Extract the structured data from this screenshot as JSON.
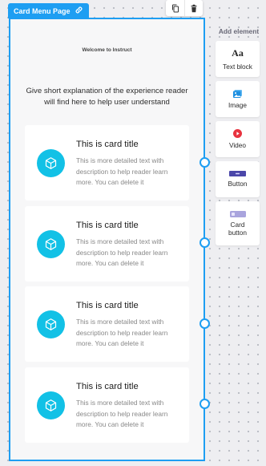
{
  "page_tab": {
    "label": "Card Menu Page",
    "icon": "link-icon"
  },
  "toolbar": {
    "duplicate_icon": "copy-icon",
    "delete_icon": "trash-icon"
  },
  "page": {
    "welcome": "Welcome to Instruct",
    "intro": "Give short explanation of the experience reader will find here to help user understand",
    "cards": [
      {
        "title": "This is card title",
        "text": "This is more detailed text with description to help reader learn more. You can delete it",
        "icon": "cube-icon"
      },
      {
        "title": "This is card title",
        "text": "This is more detailed text with description to help reader learn more. You can delete it",
        "icon": "cube-icon"
      },
      {
        "title": "This is card title",
        "text": "This is more detailed text with description to help reader learn more. You can delete it",
        "icon": "cube-icon"
      },
      {
        "title": "This is card title",
        "text": "This is more detailed text with description to help reader learn more. You can delete it",
        "icon": "cube-icon"
      }
    ]
  },
  "panel": {
    "title": "Add element",
    "items": [
      {
        "label": "Text block",
        "icon": "text-icon",
        "glyph": "Aa"
      },
      {
        "label": "Image",
        "icon": "image-icon"
      },
      {
        "label": "Video",
        "icon": "video-play-icon"
      },
      {
        "label": "Button",
        "icon": "button-icon"
      },
      {
        "label": "Card button",
        "icon": "card-button-icon"
      }
    ]
  },
  "colors": {
    "accent": "#1e9ef2",
    "card_icon": "#12c1e6",
    "video": "#e8333f",
    "button_icon": "#4b47a9",
    "card_button_icon": "#a9a4dd"
  }
}
